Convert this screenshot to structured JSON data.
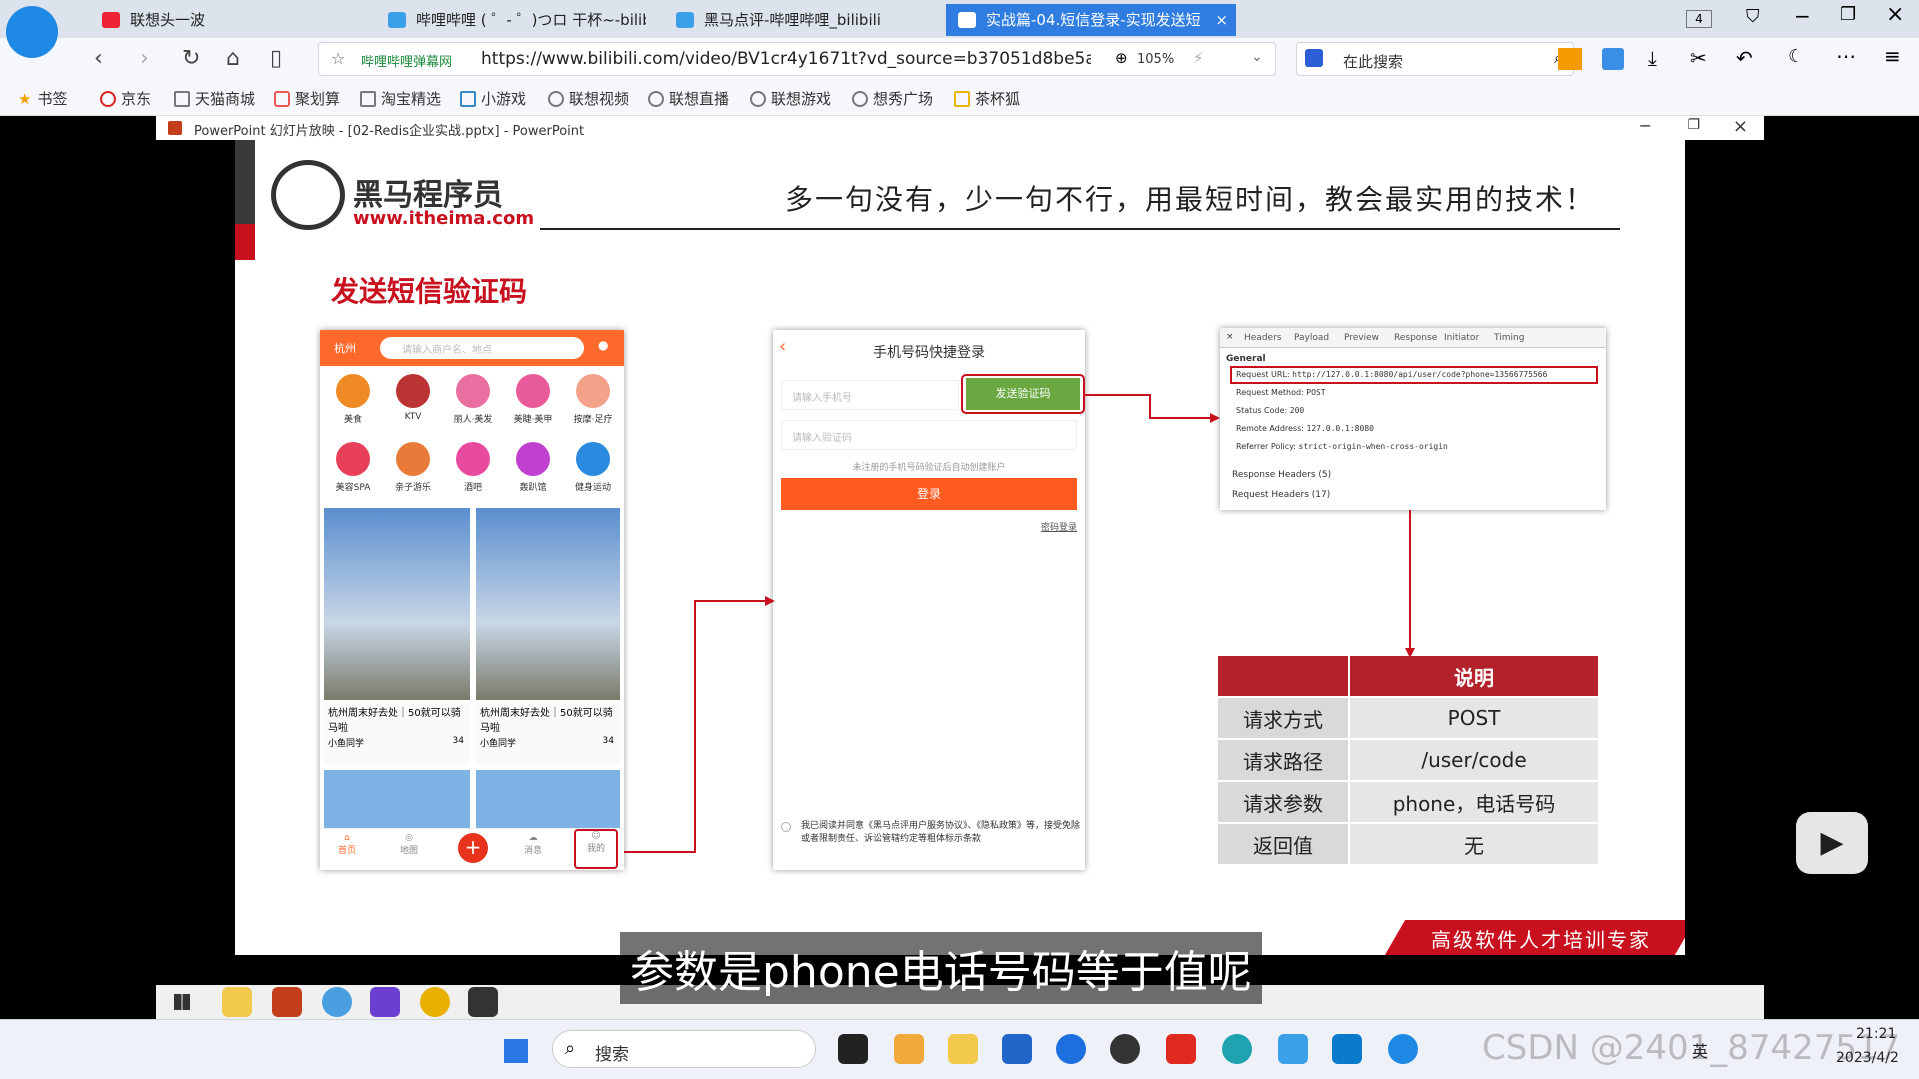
{
  "browser": {
    "tabs": [
      {
        "label": "联想头一波"
      },
      {
        "label": "哔哩哔哩 ( ゜- ゜)つロ 干杯~-bilib"
      },
      {
        "label": "黑马点评-哔哩哔哩_bilibili"
      },
      {
        "label": "实战篇-04.短信登录-实现发送短"
      }
    ],
    "tab_count": "4",
    "url_site": "哔哩哔哩弹幕网",
    "url": "https://www.bilibili.com/video/BV1cr4y1671t?vd_source=b37051d8be5a2",
    "zoom": "105%",
    "search_placeholder": "在此搜索",
    "bookmarks": [
      "书签",
      "京东",
      "天猫商城",
      "聚划算",
      "淘宝精选",
      "小游戏",
      "联想视频",
      "联想直播",
      "联想游戏",
      "想秀广场",
      "茶杯狐"
    ]
  },
  "ppt": {
    "window_title": "PowerPoint 幻灯片放映 - [02-Redis企业实战.pptx] - PowerPoint"
  },
  "slide": {
    "logo_name": "黑马程序员",
    "logo_url": "www.itheima.com",
    "slogan": "多一句没有，少一句不行，用最短时间，教会最实用的技术！",
    "title": "发送短信验证码",
    "footer": "高级软件人才培训专家",
    "phone": {
      "city": "杭州",
      "search_placeholder": "请输入商户名、地点",
      "categories": [
        "美食",
        "KTV",
        "丽人·美发",
        "美睫·美甲",
        "按摩·足疗",
        "美容SPA",
        "亲子游乐",
        "酒吧",
        "轰趴馆",
        "健身运动"
      ],
      "cards": [
        {
          "title": "杭州周末好去处｜50就可以骑马啦",
          "user": "小鱼同学",
          "likes": "34"
        },
        {
          "title": "杭州周末好去处｜50就可以骑马啦",
          "user": "小鱼同学",
          "likes": "34"
        }
      ],
      "nav": [
        "首页",
        "地图",
        "",
        "消息",
        "我的"
      ]
    },
    "login": {
      "title": "手机号码快捷登录",
      "phone_placeholder": "请输入手机号",
      "send_button": "发送验证码",
      "code_placeholder": "请输入验证码",
      "hint": "未注册的手机号码验证后自动创建账户",
      "login_button": "登录",
      "pwd_login": "密码登录",
      "agreement": "我已阅读并同意《黑马点评用户服务协议》、《隐私政策》等，接受免除或者限制责任、诉讼管辖约定等粗体标示条款"
    },
    "devtools": {
      "tabs": [
        "Headers",
        "Payload",
        "Preview",
        "Response",
        "Initiator",
        "Timing"
      ],
      "general": "General",
      "rows": [
        {
          "k": "Request URL:",
          "v": "http://127.0.0.1:8080/api/user/code?phone=13566775566"
        },
        {
          "k": "Request Method:",
          "v": "POST"
        },
        {
          "k": "Status Code:",
          "v": "200"
        },
        {
          "k": "Remote Address:",
          "v": "127.0.0.1:8080"
        },
        {
          "k": "Referrer Policy:",
          "v": "strict-origin-when-cross-origin"
        }
      ],
      "resp_headers": "Response Headers (5)",
      "req_headers": "Request Headers (17)"
    },
    "table": {
      "header": "说明",
      "rows": [
        {
          "k": "请求方式",
          "v": "POST"
        },
        {
          "k": "请求路径",
          "v": "/user/code"
        },
        {
          "k": "请求参数",
          "v": "phone，电话号码"
        },
        {
          "k": "返回值",
          "v": "无"
        }
      ]
    }
  },
  "subtitle": "参数是phone电话号码等于值呢",
  "taskbar": {
    "search": "搜索",
    "lang": "英",
    "time": "21:21",
    "date": "2023/4/2",
    "watermark": "CSDN @2401_87427517"
  }
}
